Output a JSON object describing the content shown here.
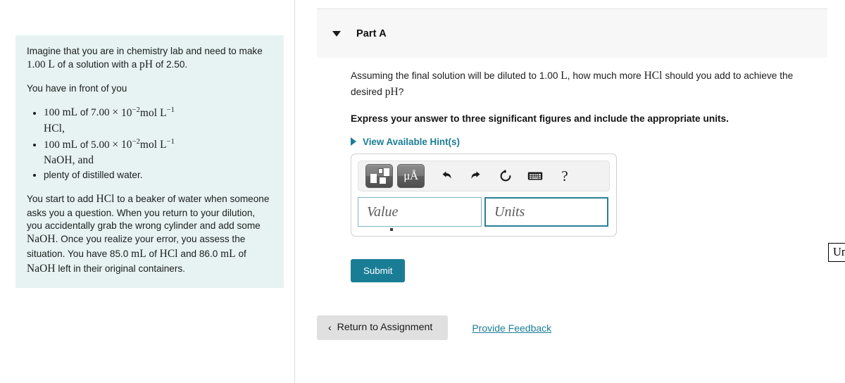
{
  "problem": {
    "intro_line_1": "Imagine that you are in chemistry lab and need to",
    "intro_line_2_pre": "make",
    "intro_volume": "1.00",
    "intro_unit": "L",
    "intro_line_2_mid": "of a solution with a",
    "intro_ph_symbol": "pH",
    "intro_line_2_post": "of 2.50.",
    "have_label": "You have in front of you",
    "items": [
      {
        "amount": "100",
        "amount_unit": "mL",
        "of": "of",
        "conc": "7.00",
        "times": "×",
        "base": "10",
        "exponent": "−2",
        "conc_unit": "mol L",
        "conc_unit_exp": "−1",
        "species": "HCl,"
      },
      {
        "amount": "100",
        "amount_unit": "mL",
        "of": "of",
        "conc": "5.00",
        "times": "×",
        "base": "10",
        "exponent": "−2",
        "conc_unit": "mol L",
        "conc_unit_exp": "−1",
        "species": "NaOH, and"
      }
    ],
    "item_plain": "plenty of distilled water.",
    "narrative": {
      "s1": "You start to add",
      "hcl": "HCl",
      "s2": "to a beaker of water when someone asks you a question. When you return to your dilution, you accidentally grab the wrong cylinder and add some",
      "naoh": "NaOH",
      "s3": ". Once you realize your error, you assess the situation. You have 85.0",
      "ml1": "mL",
      "s4": "of",
      "hcl2": "HCl",
      "s5": "and 86.0",
      "ml2": "mL",
      "s6": "of",
      "naoh2": "NaOH",
      "s7": "left in their original containers."
    }
  },
  "part": {
    "title": "Part A",
    "toggle_icon": "caret-down-icon",
    "question_pre": "Assuming the final solution will be diluted to 1.00",
    "question_unit": "L",
    "question_mid": ", how much more",
    "question_species": "HCl",
    "question_post": "should you add to achieve the desired",
    "question_ph": "pH",
    "question_end": "?",
    "instruction": "Express your answer to three significant figures and include the appropriate units.",
    "hint_link": "View Available Hint(s)"
  },
  "answer": {
    "toolbar": {
      "template_button_title": "math-template-icon",
      "units_button_label": "μÅ",
      "undo_icon": "undo-arrow-icon",
      "redo_icon": "redo-arrow-icon",
      "reset_icon": "reset-circular-arrow-icon",
      "keyboard_icon": "keyboard-icon",
      "help_label": "?"
    },
    "value_placeholder": "Value",
    "units_placeholder": "Units",
    "value_text": "Value",
    "units_text": "Units",
    "tooltip": "Units input for part A",
    "submit_label": "Submit"
  },
  "footer": {
    "return_chevron": "‹",
    "return_label": "Return to Assignment",
    "feedback_label": "Provide Feedback"
  },
  "colors": {
    "accent_teal": "#1a7d96",
    "panel_bg": "#e6f3f2",
    "header_bg": "#f7f7f7",
    "focus_border": "#2b7f96",
    "button_gray": "#e0e0e0"
  }
}
